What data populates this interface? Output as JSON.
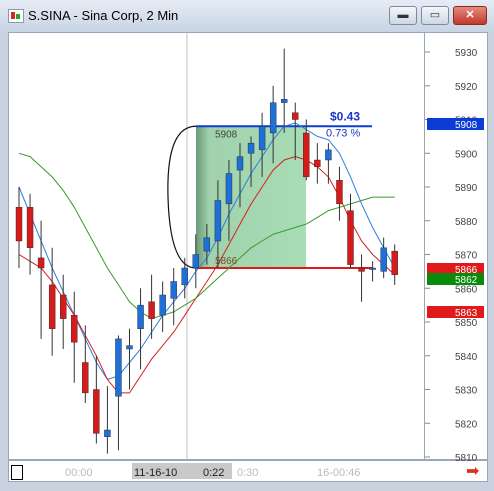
{
  "window": {
    "title": "S.SINA - Sina Corp, 2 Min",
    "minimize_label": "▬",
    "maximize_label": "▭",
    "close_label": "✕"
  },
  "price_axis": {
    "ticks": [
      "5930",
      "5920",
      "5910",
      "5900",
      "5890",
      "5880",
      "5870",
      "5860",
      "5850",
      "5840",
      "5830",
      "5820",
      "5810"
    ]
  },
  "price_tags": [
    {
      "label": "5908",
      "bg": "#0b3dd6",
      "fg": "#ffffff"
    },
    {
      "label": "5866",
      "bg": "#e01a1a",
      "fg": "#ffffff"
    },
    {
      "label": "5862",
      "bg": "#0a8a0a",
      "fg": "#ffffff"
    },
    {
      "label": "5863",
      "bg": "#e01a1a",
      "fg": "#ffffff"
    }
  ],
  "time_axis": {
    "labels": [
      "00:00",
      "11-16-10",
      "0:22",
      "0:30",
      "16-00:46"
    ]
  },
  "annotation": {
    "gain": "$0.43",
    "gain_pct": "0.73 %",
    "top_price": "5908",
    "bottom_price": "5866"
  },
  "chart_data": {
    "type": "candlestick",
    "symbol": "S.SINA",
    "interval": "2 Min",
    "ylim": [
      5806,
      5939
    ],
    "candles": [
      {
        "o": 5884,
        "h": 5890,
        "l": 5866,
        "c": 5874
      },
      {
        "o": 5884,
        "h": 5888,
        "l": 5864,
        "c": 5872
      },
      {
        "o": 5869,
        "h": 5880,
        "l": 5845,
        "c": 5866
      },
      {
        "o": 5861,
        "h": 5872,
        "l": 5840,
        "c": 5848
      },
      {
        "o": 5858,
        "h": 5864,
        "l": 5842,
        "c": 5851
      },
      {
        "o": 5852,
        "h": 5859,
        "l": 5832,
        "c": 5844
      },
      {
        "o": 5838,
        "h": 5849,
        "l": 5826,
        "c": 5829
      },
      {
        "o": 5830,
        "h": 5840,
        "l": 5814,
        "c": 5817
      },
      {
        "o": 5816,
        "h": 5831,
        "l": 5811,
        "c": 5818
      },
      {
        "o": 5828,
        "h": 5846,
        "l": 5812,
        "c": 5845
      },
      {
        "o": 5842,
        "h": 5848,
        "l": 5830,
        "c": 5843
      },
      {
        "o": 5848,
        "h": 5860,
        "l": 5836,
        "c": 5855
      },
      {
        "o": 5856,
        "h": 5864,
        "l": 5845,
        "c": 5851
      },
      {
        "o": 5852,
        "h": 5862,
        "l": 5847,
        "c": 5858
      },
      {
        "o": 5857,
        "h": 5866,
        "l": 5849,
        "c": 5862
      },
      {
        "o": 5861,
        "h": 5869,
        "l": 5857,
        "c": 5866
      },
      {
        "o": 5866,
        "h": 5876,
        "l": 5860,
        "c": 5870
      },
      {
        "o": 5871,
        "h": 5879,
        "l": 5867,
        "c": 5875
      },
      {
        "o": 5874,
        "h": 5892,
        "l": 5866,
        "c": 5886
      },
      {
        "o": 5885,
        "h": 5898,
        "l": 5874,
        "c": 5894
      },
      {
        "o": 5895,
        "h": 5903,
        "l": 5884,
        "c": 5899
      },
      {
        "o": 5900,
        "h": 5905,
        "l": 5890,
        "c": 5903
      },
      {
        "o": 5901,
        "h": 5912,
        "l": 5893,
        "c": 5908
      },
      {
        "o": 5906,
        "h": 5920,
        "l": 5897,
        "c": 5915
      },
      {
        "o": 5915,
        "h": 5931,
        "l": 5906,
        "c": 5916
      },
      {
        "o": 5912,
        "h": 5915,
        "l": 5898,
        "c": 5910
      },
      {
        "o": 5906,
        "h": 5910,
        "l": 5892,
        "c": 5893
      },
      {
        "o": 5898,
        "h": 5903,
        "l": 5891,
        "c": 5896
      },
      {
        "o": 5898,
        "h": 5903,
        "l": 5891,
        "c": 5901
      },
      {
        "o": 5892,
        "h": 5896,
        "l": 5880,
        "c": 5885
      },
      {
        "o": 5883,
        "h": 5888,
        "l": 5866,
        "c": 5867
      },
      {
        "o": 5866,
        "h": 5870,
        "l": 5856,
        "c": 5865
      },
      {
        "o": 5866,
        "h": 5868,
        "l": 5862,
        "c": 5866
      },
      {
        "o": 5865,
        "h": 5875,
        "l": 5863,
        "c": 5872
      },
      {
        "o": 5871,
        "h": 5873,
        "l": 5861,
        "c": 5864
      }
    ],
    "series": [
      {
        "color": "#2d7fe0",
        "values": [
          5890,
          5882,
          5874,
          5866,
          5859,
          5852,
          5845,
          5838,
          5833,
          5834,
          5838,
          5842,
          5847,
          5852,
          5856,
          5860,
          5865,
          5869,
          5875,
          5882,
          5888,
          5894,
          5899,
          5904,
          5908,
          5909,
          5907,
          5905,
          5904,
          5900,
          5893,
          5885,
          5878,
          5872,
          5866
        ]
      },
      {
        "color": "#d42020",
        "values": [
          5870,
          5868,
          5866,
          5862,
          5857,
          5852,
          5846,
          5840,
          5833,
          5829,
          5829,
          5834,
          5839,
          5843,
          5847,
          5852,
          5857,
          5862,
          5867,
          5873,
          5879,
          5885,
          5890,
          5895,
          5898,
          5899,
          5898,
          5896,
          5893,
          5887,
          5880,
          5874,
          5870,
          5867,
          5864
        ]
      },
      {
        "color": "#3a9a2a",
        "values": [
          5900,
          5899,
          5896,
          5893,
          5889,
          5884,
          5878,
          5872,
          5866,
          5861,
          5856,
          5853,
          5851,
          5852,
          5853,
          5855,
          5857,
          5860,
          5863,
          5866,
          5869,
          5872,
          5874,
          5876,
          5877,
          5878,
          5879,
          5881,
          5883,
          5884,
          5885,
          5886,
          5887,
          5887,
          5887
        ]
      }
    ]
  }
}
